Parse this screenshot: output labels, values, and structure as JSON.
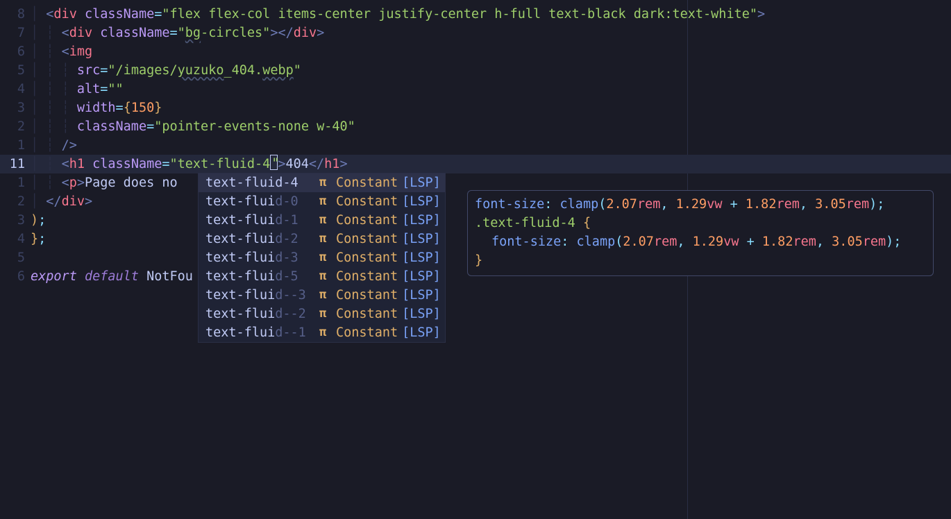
{
  "gutter": [
    "8",
    "7",
    "6",
    "5",
    "4",
    "3",
    "2",
    "1",
    "11",
    "1",
    "2",
    "3",
    "4",
    "5",
    "6"
  ],
  "current_line_index": 8,
  "code_lines": {
    "l0": {
      "indent": 1,
      "tag": "div",
      "attrs": [
        {
          "n": "className",
          "v": "flex flex-col items-center justify-center h-full text-black dark:text-white"
        }
      ],
      "close": ">"
    },
    "l1": {
      "indent": 2,
      "tag": "div",
      "attrs": [
        {
          "n": "className",
          "v": "bg-circles",
          "ul": "bg"
        }
      ],
      "close": "></div>"
    },
    "l2": {
      "indent": 2,
      "tag": "img"
    },
    "l3": {
      "indent": 3,
      "attr_only": {
        "n": "src",
        "v": "/images/yuzuko_404.webp",
        "ul_parts": [
          "yuzuko",
          "webp"
        ]
      }
    },
    "l4": {
      "indent": 3,
      "attr_only": {
        "n": "alt",
        "v": ""
      }
    },
    "l5": {
      "indent": 3,
      "attr_only_brace": {
        "n": "width",
        "v": "150"
      }
    },
    "l6": {
      "indent": 3,
      "attr_only": {
        "n": "className",
        "v": "pointer-events-none w-40"
      }
    },
    "l7": {
      "indent": 2,
      "selfclose": "/>"
    },
    "l8": {
      "indent": 2,
      "h1_line": true,
      "className": "text-fluid-4",
      "text": "404"
    },
    "l9": {
      "indent": 2,
      "p_open": "p",
      "p_text": "Page does no"
    },
    "l10": {
      "indent": 1,
      "closetag": "div"
    },
    "l11": {
      "indent": 0,
      "raw_paren": ");"
    },
    "l12": {
      "indent": 0,
      "raw_brace": "};"
    },
    "l13": {
      "blank": true
    },
    "l14": {
      "export_line": {
        "kw": "export",
        "def": "default",
        "ident": "NotFou"
      }
    }
  },
  "completion": {
    "items": [
      {
        "pre": "text-fluid-4",
        "dim": "",
        "sel": true
      },
      {
        "pre": "text-flui",
        "dim": "d-0"
      },
      {
        "pre": "text-flui",
        "dim": "d-1"
      },
      {
        "pre": "text-flui",
        "dim": "d-2"
      },
      {
        "pre": "text-flui",
        "dim": "d-3"
      },
      {
        "pre": "text-flui",
        "dim": "d-5"
      },
      {
        "pre": "text-flui",
        "dim": "d--3"
      },
      {
        "pre": "text-flui",
        "dim": "d--2"
      },
      {
        "pre": "text-flui",
        "dim": "d--1"
      }
    ],
    "icon": "π",
    "kind": "Constant",
    "source": "[LSP]"
  },
  "doc": {
    "line1": {
      "prop": "font-size",
      "fn": "clamp",
      "a": "2.07",
      "au": "rem",
      "b": "1.29",
      "bu": "vw",
      "op": "+",
      "c": "1.82",
      "cu": "rem",
      "d": "3.05",
      "du": "rem"
    },
    "selector": ".text-fluid-4",
    "line3": {
      "prop": "font-size",
      "fn": "clamp",
      "a": "2.07",
      "au": "rem",
      "b": "1.29",
      "bu": "vw",
      "op": "+",
      "c": "1.82",
      "cu": "rem",
      "d": "3.05",
      "du": "rem"
    }
  }
}
